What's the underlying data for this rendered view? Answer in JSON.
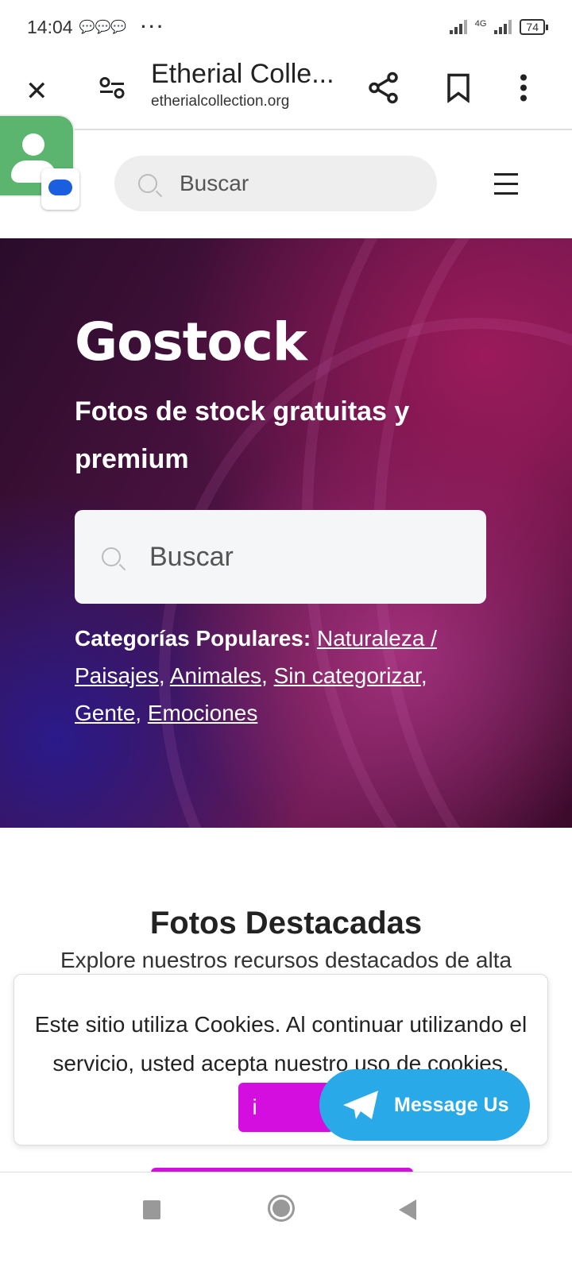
{
  "status_bar": {
    "time": "14:04",
    "network": "4G",
    "battery": "74"
  },
  "browser": {
    "title": "Etherial Colle...",
    "url": "etherialcollection.org"
  },
  "site_header": {
    "search_placeholder": "Buscar"
  },
  "hero": {
    "title": "Gostock",
    "subtitle": "Fotos de stock gratuitas y premium",
    "search_placeholder": "Buscar",
    "categories_label": "Categorías Populares:",
    "categories": [
      "Naturaleza / Paisajes",
      "Animales",
      "Sin categorizar",
      "Gente",
      "Emociones"
    ]
  },
  "featured": {
    "title": "Fotos Destacadas",
    "description": "Explore nuestros recursos destacados de alta"
  },
  "cookie": {
    "text": "Este sitio utiliza Cookies. Al continuar utilizando el servicio, usted acepta nuestro uso de cookies.",
    "button": "i"
  },
  "message_us": {
    "label": "Message Us"
  },
  "colors": {
    "accent": "#d50ee0",
    "telegram": "#2aa9e8"
  }
}
